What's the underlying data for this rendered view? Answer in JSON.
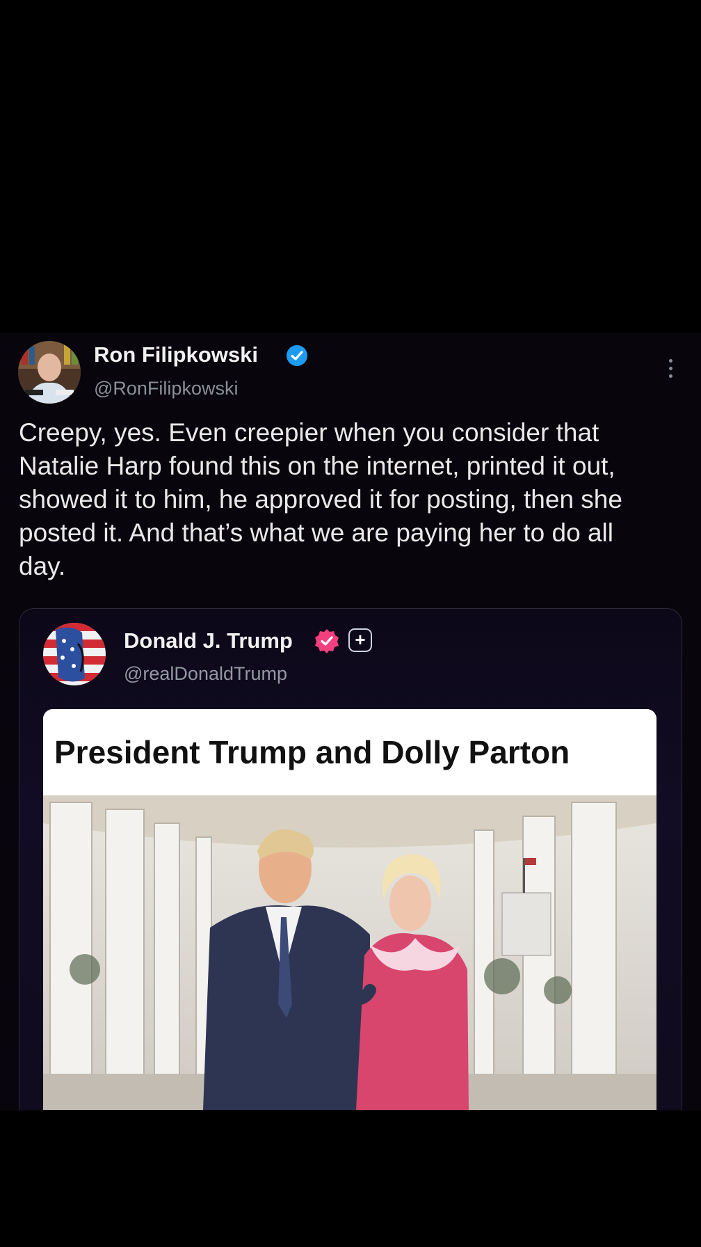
{
  "post": {
    "author_name": "Ron Filipkowski",
    "author_handle": "@RonFilipkowski",
    "text": "Creepy, yes. Even creepier when you consider that Natalie Harp found this on the internet, printed it out, showed it to him, he approved it for posting, then she posted it. And that’s what we are paying her to do all day.",
    "verified_icon": "blue-check-icon",
    "verified_color": "#1d9bf0",
    "more_icon": "vertical-ellipsis-icon"
  },
  "quoted_post": {
    "author_name": "Donald J. Trump",
    "author_handle": "@realDonaldTrump",
    "verified_icon": "pink-check-icon",
    "verified_color": "#f43f7f",
    "plus_badge": "+",
    "image_title": "President Trump and Dolly Parton"
  },
  "colors": {
    "background": "#000000",
    "post_background": "#08050d",
    "handle_gray": "#8b8f96"
  }
}
